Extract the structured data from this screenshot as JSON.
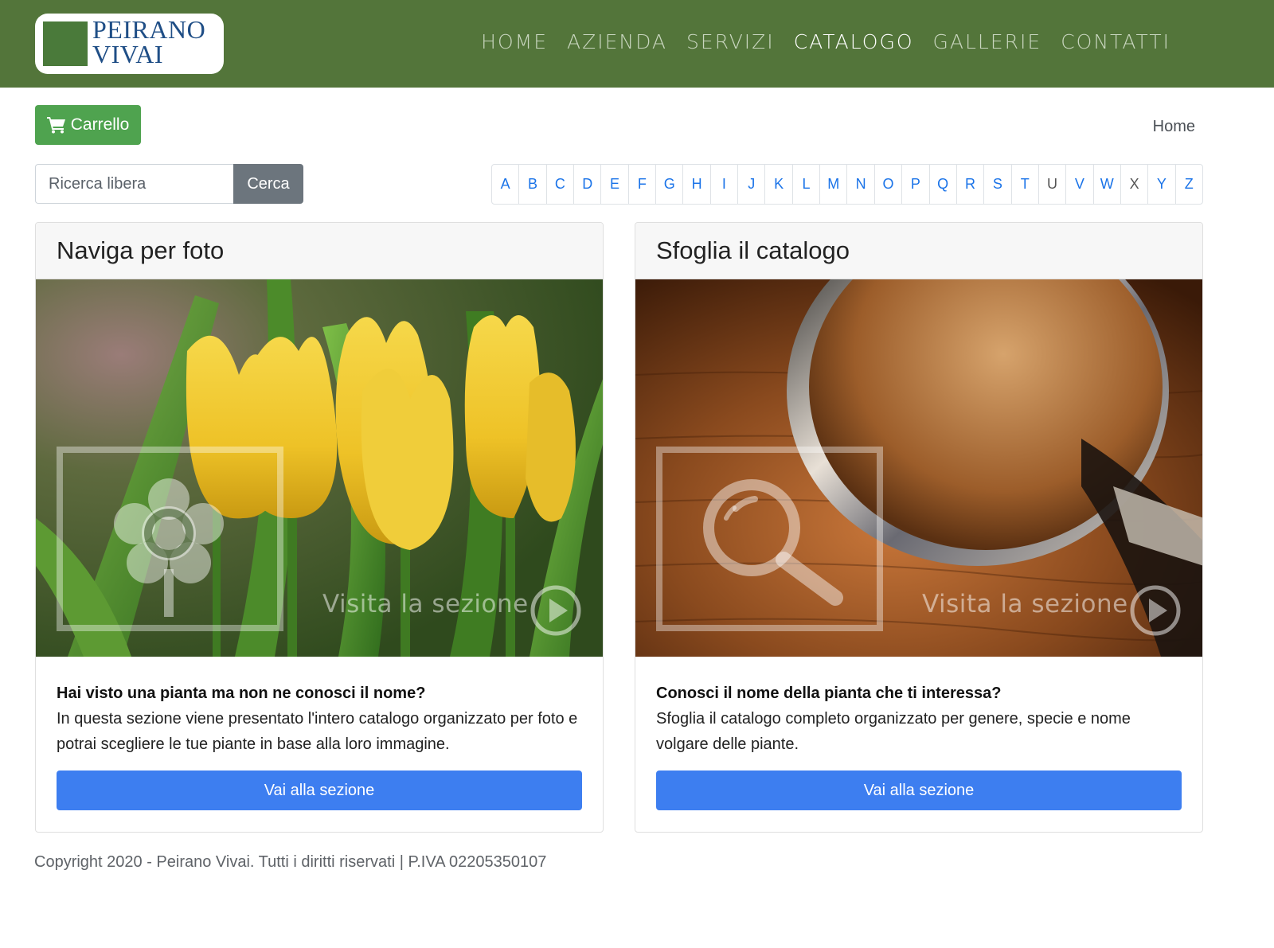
{
  "header": {
    "logo": {
      "line1": "PEIRANO",
      "line2": "VIVAI"
    },
    "nav": [
      {
        "label": "HOME",
        "active": false
      },
      {
        "label": "AZIENDA",
        "active": false
      },
      {
        "label": "SERVIZI",
        "active": false
      },
      {
        "label": "CATALOGO",
        "active": true
      },
      {
        "label": "GALLERIE",
        "active": false
      },
      {
        "label": "CONTATTI",
        "active": false
      }
    ]
  },
  "toolbar": {
    "cart_label": "Carrello",
    "cart_icon": "shopping-cart-icon",
    "breadcrumb_home": "Home"
  },
  "search": {
    "placeholder": "Ricerca libera",
    "value": "",
    "button_label": "Cerca"
  },
  "alphabet": [
    "A",
    "B",
    "C",
    "D",
    "E",
    "F",
    "G",
    "H",
    "I",
    "J",
    "K",
    "L",
    "M",
    "N",
    "O",
    "P",
    "Q",
    "R",
    "S",
    "T",
    "U",
    "V",
    "W",
    "X",
    "Y",
    "Z"
  ],
  "cards": [
    {
      "title": "Naviga per foto",
      "overlay_text": "Visita la sezione",
      "overlay_icon": "flower-icon",
      "lead": "Hai visto una pianta ma non ne conosci il nome?",
      "text": "In questa sezione viene presentato l'intero catalogo organizzato per foto e potrai scegliere le tue piante in base alla loro immagine.",
      "button_label": "Vai alla sezione"
    },
    {
      "title": "Sfoglia il catalogo",
      "overlay_text": "Visita la sezione",
      "overlay_icon": "magnifier-icon",
      "lead": "Conosci il nome della pianta che ti interessa?",
      "text": "Sfoglia il catalogo completo organizzato per genere, specie e nome volgare delle piante.",
      "button_label": "Vai alla sezione"
    }
  ],
  "footer": {
    "text": "Copyright 2020 - Peirano Vivai. Tutti i diritti riservati | P.IVA 02205350107"
  },
  "colors": {
    "header_bg": "#53753a",
    "cart_button": "#4fa34f",
    "primary_button": "#3d7ef0",
    "search_button": "#6c757d",
    "link": "#1a73e8"
  }
}
